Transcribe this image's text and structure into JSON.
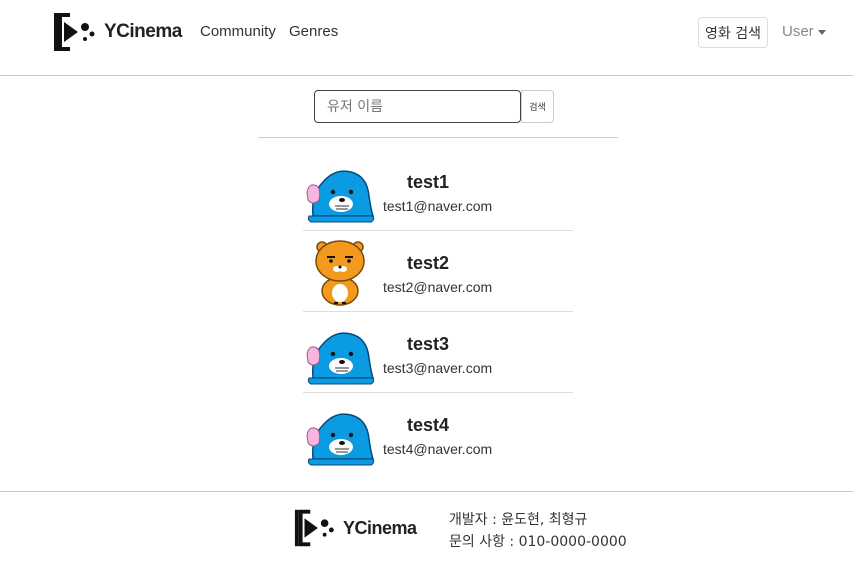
{
  "navbar": {
    "brand": "YCinema",
    "links": [
      "Community",
      "Genres"
    ],
    "movie_search_label": "영화 검색",
    "user_menu_label": "User"
  },
  "search": {
    "placeholder": "유저 이름",
    "value": "",
    "button_label": "검색"
  },
  "users": [
    {
      "name": "test1",
      "email": "test1@naver.com",
      "avatar": "blue-seal-avatar"
    },
    {
      "name": "test2",
      "email": "test2@naver.com",
      "avatar": "orange-lion-avatar"
    },
    {
      "name": "test3",
      "email": "test3@naver.com",
      "avatar": "blue-seal-avatar"
    },
    {
      "name": "test4",
      "email": "test4@naver.com",
      "avatar": "blue-seal-avatar"
    }
  ],
  "footer": {
    "brand": "YCinema",
    "developers": "개발자 : 윤도현, 최형규",
    "contact": "문의 사항 : 010-0000-0000"
  },
  "colors": {
    "seal_blue": "#0b9be3",
    "lion_orange": "#f39a1e",
    "border": "#cccccc"
  }
}
